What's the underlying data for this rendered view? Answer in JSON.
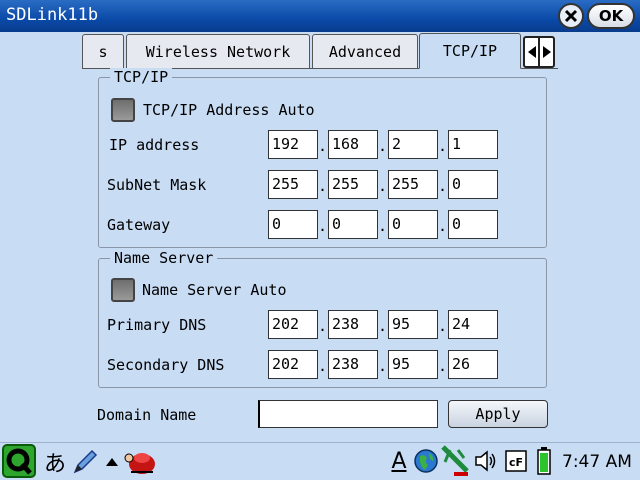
{
  "window": {
    "title": "SDLink11b",
    "ok_label": "OK"
  },
  "tabs": [
    {
      "label": "s"
    },
    {
      "label": "Wireless Network"
    },
    {
      "label": "Advanced"
    },
    {
      "label": "TCP/IP"
    }
  ],
  "tcpip": {
    "legend": "TCP/IP",
    "auto_label": "TCP/IP Address Auto",
    "ip_label": "IP address",
    "ip": [
      "192",
      "168",
      "2",
      "1"
    ],
    "mask_label": "SubNet Mask",
    "mask": [
      "255",
      "255",
      "255",
      "0"
    ],
    "gateway_label": "Gateway",
    "gateway": [
      "0",
      "0",
      "0",
      "0"
    ]
  },
  "name_server": {
    "legend": "Name Server",
    "auto_label": "Name Server Auto",
    "primary_label": "Primary DNS",
    "primary": [
      "202",
      "238",
      "95",
      "24"
    ],
    "secondary_label": "Secondary DNS",
    "secondary": [
      "202",
      "238",
      "95",
      "26"
    ]
  },
  "domain": {
    "label": "Domain Name",
    "value": "",
    "apply_label": "Apply"
  },
  "taskbar": {
    "ime": "あ",
    "input_mode": "A",
    "clock": "7:47 AM"
  }
}
